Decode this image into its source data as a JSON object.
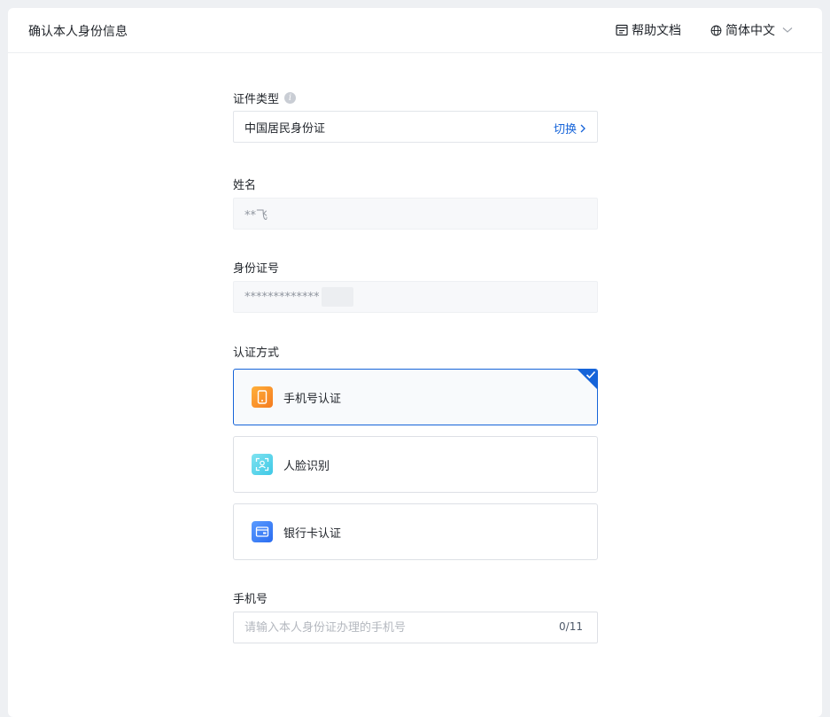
{
  "header": {
    "title": "确认本人身份信息",
    "help_label": "帮助文档",
    "language_label": "简体中文"
  },
  "form": {
    "id_type": {
      "label": "证件类型",
      "value": "中国居民身份证",
      "switch_label": "切换"
    },
    "name": {
      "label": "姓名",
      "value": "**飞"
    },
    "id_number": {
      "label": "身份证号",
      "value": "*************"
    },
    "verify_method": {
      "label": "认证方式",
      "options": [
        {
          "label": "手机号认证",
          "icon": "phone-icon",
          "color": "#f57b1f",
          "selected": true
        },
        {
          "label": "人脸识别",
          "icon": "face-scan-icon",
          "color": "#3ec8e6",
          "selected": false
        },
        {
          "label": "银行卡认证",
          "icon": "bank-card-icon",
          "color": "#2a6cf0",
          "selected": false
        }
      ]
    },
    "phone": {
      "label": "手机号",
      "placeholder": "请输入本人身份证办理的手机号",
      "value": "",
      "counter": "0/11"
    }
  },
  "colors": {
    "accent": "#1664d9",
    "page_background": "#eef0f3"
  }
}
